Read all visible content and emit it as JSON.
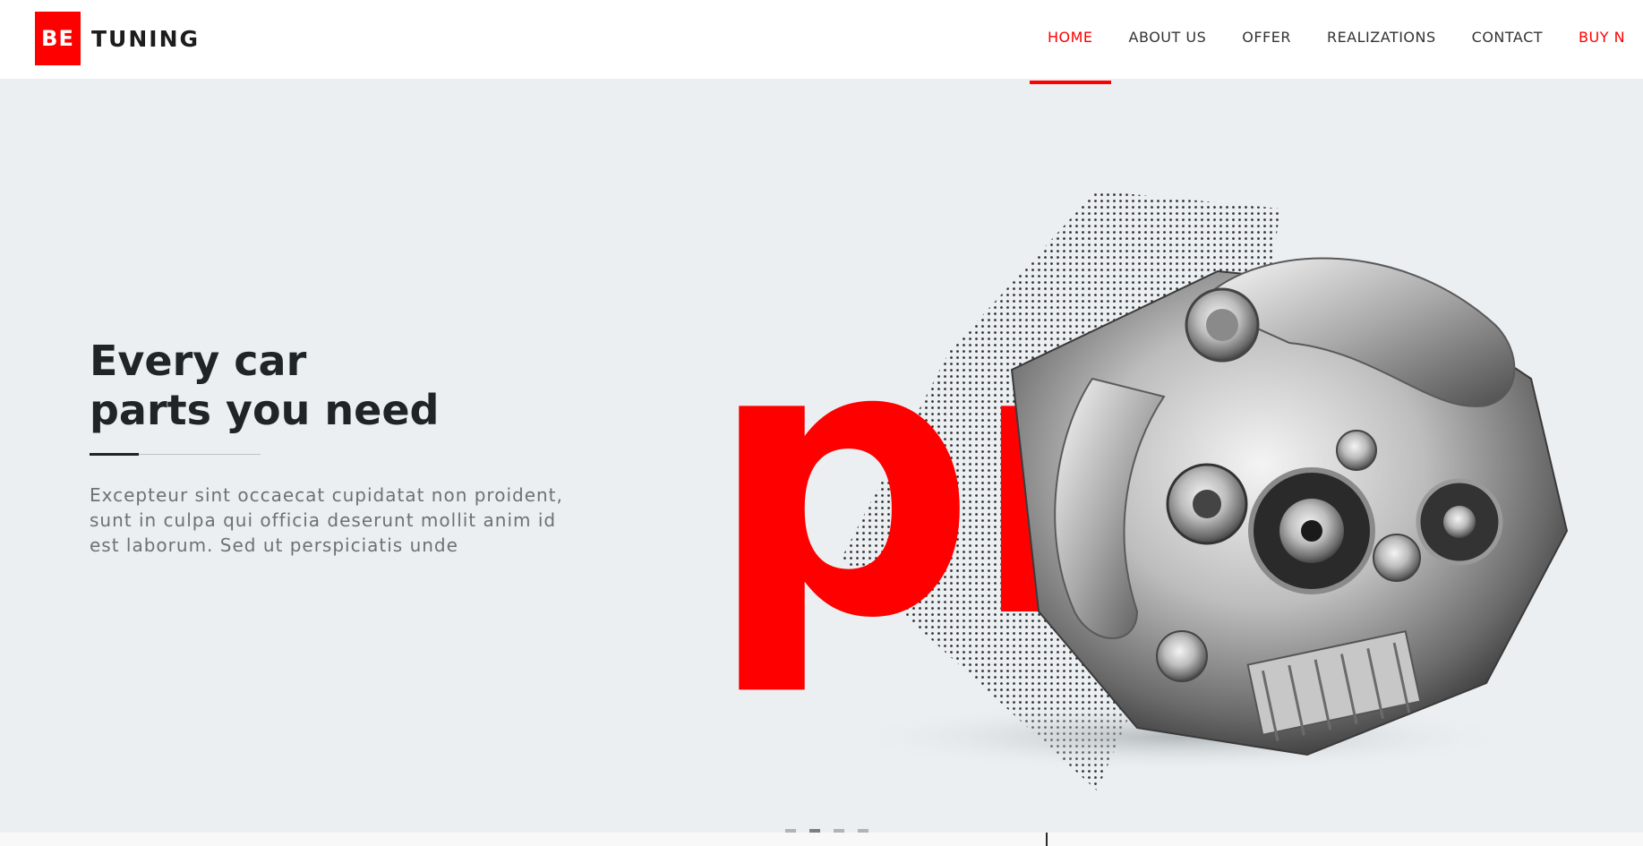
{
  "brand": {
    "logo_mark": "BE",
    "logo_text": "TUNING",
    "accent_color": "#ff0000"
  },
  "nav": {
    "items": [
      {
        "label": "HOME",
        "active": true
      },
      {
        "label": "ABOUT US"
      },
      {
        "label": "OFFER"
      },
      {
        "label": "REALIZATIONS"
      },
      {
        "label": "CONTACT"
      },
      {
        "label": "BUY N"
      }
    ]
  },
  "hero": {
    "title_line1": "Every car",
    "title_line2": "parts you need",
    "text": "Excepteur sint occaecat cupidatat non proident, sunt in culpa qui officia deserunt mollit anim id est laborum. Sed ut perspiciatis unde",
    "big_word": "pro",
    "image_subject": "car-engine-image",
    "background_color": "#ebeff2"
  },
  "slider": {
    "dot_count": 4,
    "active_index": 1
  }
}
